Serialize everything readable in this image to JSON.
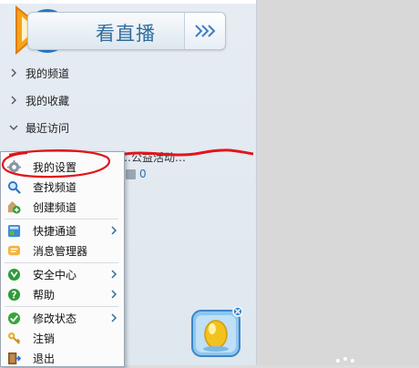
{
  "banner": {
    "label": "看直播"
  },
  "nav": [
    {
      "label": "我的频道",
      "expanded": false
    },
    {
      "label": "我的收藏",
      "expanded": false
    },
    {
      "label": "最近访问",
      "expanded": true
    }
  ],
  "recent": {
    "title": "…公益活动…",
    "count": "0"
  },
  "menu": {
    "items": [
      {
        "label": "我的设置",
        "icon": "gear-icon",
        "submenu": false
      },
      {
        "label": "查找频道",
        "icon": "search-icon",
        "submenu": false
      },
      {
        "label": "创建频道",
        "icon": "create-channel-icon",
        "submenu": false
      },
      {
        "label": "快捷通道",
        "icon": "shortcut-icon",
        "submenu": true
      },
      {
        "label": "消息管理器",
        "icon": "message-icon",
        "submenu": false
      },
      {
        "label": "安全中心",
        "icon": "shield-icon",
        "submenu": true
      },
      {
        "label": "帮助",
        "icon": "help-icon",
        "submenu": true
      },
      {
        "label": "修改状态",
        "icon": "status-check-icon",
        "submenu": true
      },
      {
        "label": "注销",
        "icon": "key-icon",
        "submenu": false
      },
      {
        "label": "退出",
        "icon": "exit-icon",
        "submenu": false
      }
    ]
  },
  "colors": {
    "accent": "#2e6d9e",
    "highlight": "#e0161b",
    "link": "#2a6fb5"
  }
}
